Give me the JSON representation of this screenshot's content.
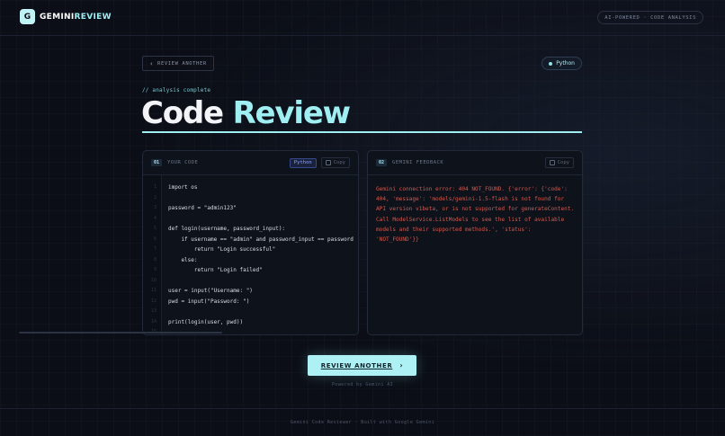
{
  "header": {
    "logo_mark": "G",
    "logo_text_a": "GEMINI",
    "logo_text_b": "REVIEW",
    "badge": "AI-POWERED · CODE ANALYSIS"
  },
  "nav": {
    "back_label": "REVIEW ANOTHER",
    "language": "Python"
  },
  "hero": {
    "status": "// analysis complete",
    "title_a": "Code",
    "title_b": "Review"
  },
  "code_panel": {
    "num": "01",
    "title": "YOUR CODE",
    "language_tag": "Python",
    "copy_label": "Copy",
    "lines": [
      "import os",
      "",
      "password = \"admin123\"",
      "",
      "def login(username, password_input):",
      "    if username == \"admin\" and password_input == password",
      "        return \"Login successful\"",
      "    else:",
      "        return \"Login failed\"",
      "",
      "user = input(\"Username: \")",
      "pwd = input(\"Password: \")",
      "",
      "print(login(user, pwd))"
    ],
    "line_numbers": [
      "1",
      "2",
      "3",
      "4",
      "5",
      "6",
      "7",
      "8",
      "9",
      "10",
      "11",
      "12",
      "13",
      "14",
      "15"
    ]
  },
  "feedback_panel": {
    "num": "02",
    "title": "GEMINI FEEDBACK",
    "copy_label": "Copy",
    "text": "Gemini connection error: 404 NOT_FOUND. {'error': {'code': 404, 'message': 'models/gemini-1.5-flash is not found for API version v1beta, or is not supported for generateContent. Call ModelService.ListModels to see the list of available models and their supported methods.', 'status': 'NOT_FOUND'}}"
  },
  "cta": {
    "label": "REVIEW ANOTHER",
    "powered": "Powered by Gemini AI"
  },
  "footer": {
    "text": "Gemini Code Reviewer · Built with Google Gemini"
  },
  "colors": {
    "accent": "#9eeef2",
    "background": "#0b0e16",
    "error": "#d25a4e",
    "python_tag": "#8fa6ff"
  }
}
